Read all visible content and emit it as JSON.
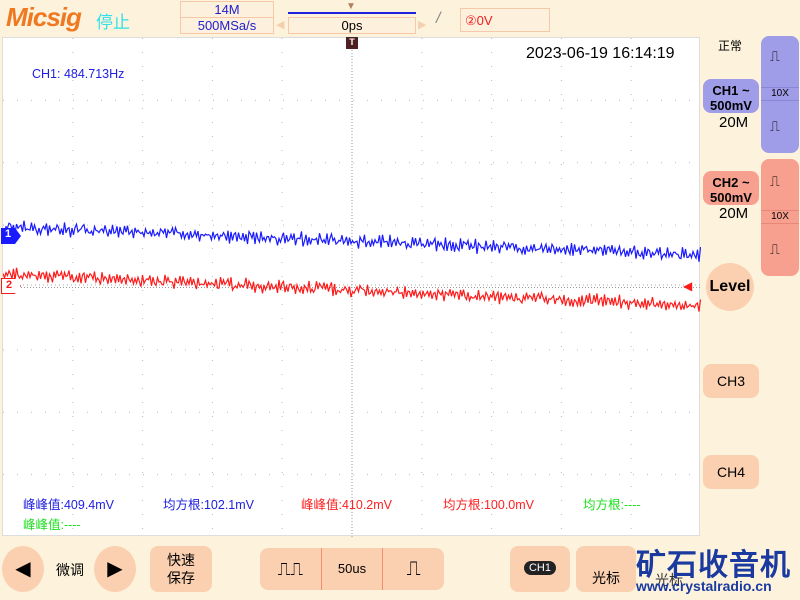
{
  "header": {
    "brand": "Micsig",
    "run_state": "停止",
    "memory_depth": "14M",
    "sample_rate": "500MSa/s",
    "time_offset": "0ps",
    "trigger_level": "②0V"
  },
  "screen": {
    "timestamp": "2023-06-19 16:14:19",
    "frequency": "CH1: 484.713Hz",
    "ch1_marker": "1",
    "ch2_marker": "2",
    "trigger_marker": "T"
  },
  "measurements": [
    {
      "text": "峰峰值:409.4mV",
      "color": "#2020e0"
    },
    {
      "text": "均方根:102.1mV",
      "color": "#2020e0"
    },
    {
      "text": "峰峰值:410.2mV",
      "color": "#ff2020"
    },
    {
      "text": "均方根:100.0mV",
      "color": "#ff2020"
    },
    {
      "text": "均方根:----",
      "color": "#20e020"
    },
    {
      "text": "峰峰值:----",
      "color": "#20e020"
    }
  ],
  "right_panel": {
    "acq_mode": "正常",
    "ch1": {
      "label": "CH1 ~",
      "scale": "500mV",
      "bw": "20M",
      "probe": "10X",
      "color": "#a09de8"
    },
    "ch2": {
      "label": "CH2 ~",
      "scale": "500mV",
      "bw": "20M",
      "probe": "10X",
      "color": "#f8a090"
    },
    "level": "Level",
    "ch3": "CH3",
    "ch4": "CH4"
  },
  "bottom": {
    "fine": "微调",
    "quick_save_1": "快速",
    "quick_save_2": "保存",
    "timebase": "50us",
    "ch_select": "CH1",
    "cursor": "光标",
    "cursor2": "光标"
  },
  "watermark": {
    "title": "矿石收音机",
    "url": "www.crystalradio.cn"
  },
  "colors": {
    "ch1": "#1a1aff",
    "ch2": "#ff1a1a"
  }
}
